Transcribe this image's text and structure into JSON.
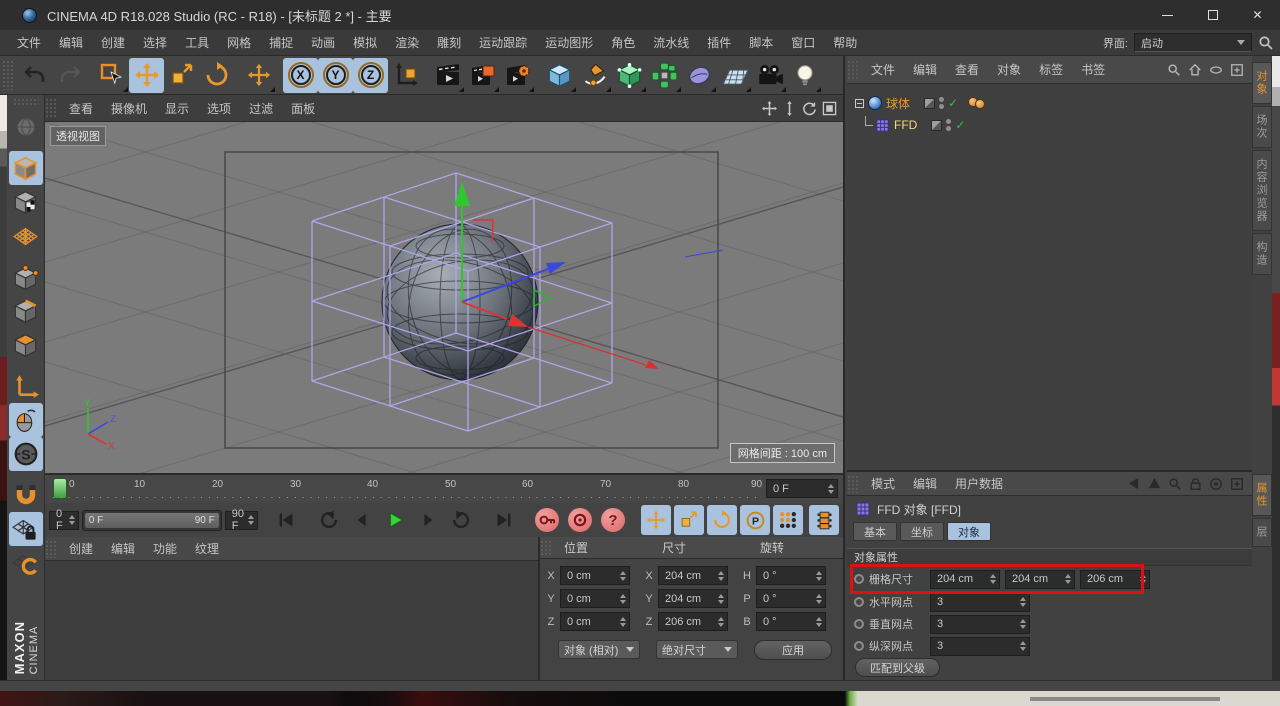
{
  "titlebar": {
    "title": "CINEMA 4D R18.028 Studio (RC - R18) - [未标题 2 *] - 主要"
  },
  "menubar": {
    "items": [
      "文件",
      "编辑",
      "创建",
      "选择",
      "工具",
      "网格",
      "捕捉",
      "动画",
      "模拟",
      "渲染",
      "雕刻",
      "运动跟踪",
      "运动图形",
      "角色",
      "流水线",
      "插件",
      "脚本",
      "窗口",
      "帮助"
    ],
    "interface_label": "界面:",
    "interface_value": "启动"
  },
  "viewport": {
    "menu": [
      "查看",
      "摄像机",
      "显示",
      "选项",
      "过滤",
      "面板"
    ],
    "view_label": "透视视图",
    "grid_spacing_label": "网格间距 : 100 cm",
    "gizmo": {
      "x": "X",
      "y": "Y",
      "z": "Z"
    }
  },
  "timeline": {
    "ticks": [
      "0",
      "10",
      "20",
      "30",
      "40",
      "50",
      "60",
      "70",
      "80",
      "90"
    ],
    "current_frame": "0 F",
    "start_frame": "0 F",
    "range_start": "0 F",
    "range_end": "90 F",
    "end_frame": "90 F"
  },
  "materials": {
    "menu": [
      "创建",
      "编辑",
      "功能",
      "纹理"
    ]
  },
  "coordinates": {
    "position": {
      "title": "位置",
      "fields": [
        {
          "axis": "X",
          "value": "0 cm"
        },
        {
          "axis": "Y",
          "value": "0 cm"
        },
        {
          "axis": "Z",
          "value": "0 cm"
        }
      ],
      "mode": "对象 (相对)"
    },
    "size": {
      "title": "尺寸",
      "fields": [
        {
          "axis": "X",
          "value": "204 cm"
        },
        {
          "axis": "Y",
          "value": "204 cm"
        },
        {
          "axis": "Z",
          "value": "206 cm"
        }
      ],
      "mode": "绝对尺寸"
    },
    "rotation": {
      "title": "旋转",
      "fields": [
        {
          "axis": "H",
          "value": "0 °"
        },
        {
          "axis": "P",
          "value": "0 °"
        },
        {
          "axis": "B",
          "value": "0 °"
        }
      ],
      "apply": "应用"
    }
  },
  "object_manager": {
    "menu": [
      "文件",
      "编辑",
      "查看",
      "对象",
      "标签",
      "书签"
    ],
    "objects": [
      {
        "name": "球体"
      },
      {
        "name": "FFD"
      }
    ],
    "side_tabs": [
      "对象",
      "场次",
      "内容浏览器",
      "构造"
    ]
  },
  "attribute_manager": {
    "menu": [
      "模式",
      "编辑",
      "用户数据"
    ],
    "object_title": "FFD 对象 [FFD]",
    "tabs": [
      "基本",
      "坐标",
      "对象"
    ],
    "active_tab": "对象",
    "section_title": "对象属性",
    "grid_size": {
      "label": "栅格尺寸",
      "values": [
        "204 cm",
        "204 cm",
        "206 cm"
      ]
    },
    "horizontal_points": {
      "label": "水平网点",
      "value": "3"
    },
    "vertical_points": {
      "label": "垂直网点",
      "value": "3"
    },
    "depth_points": {
      "label": "纵深网点",
      "value": "3"
    },
    "match_parent_button": "匹配到父级",
    "side_tabs": [
      "属性",
      "层"
    ]
  },
  "branding": {
    "logo_line1": "MAXON",
    "logo_line2": "CINEMA"
  },
  "colors": {
    "accent_orange": "#e8952c",
    "active_blue": "#a9c3df",
    "highlight_red": "#dd1111",
    "selected_object_orange": "#e09a3a",
    "ffd_text_yellow": "#f3dc7a",
    "check_green": "#3cb83c",
    "play_green": "#38d438",
    "ffd_cage_purple": "#b3a8ee"
  }
}
